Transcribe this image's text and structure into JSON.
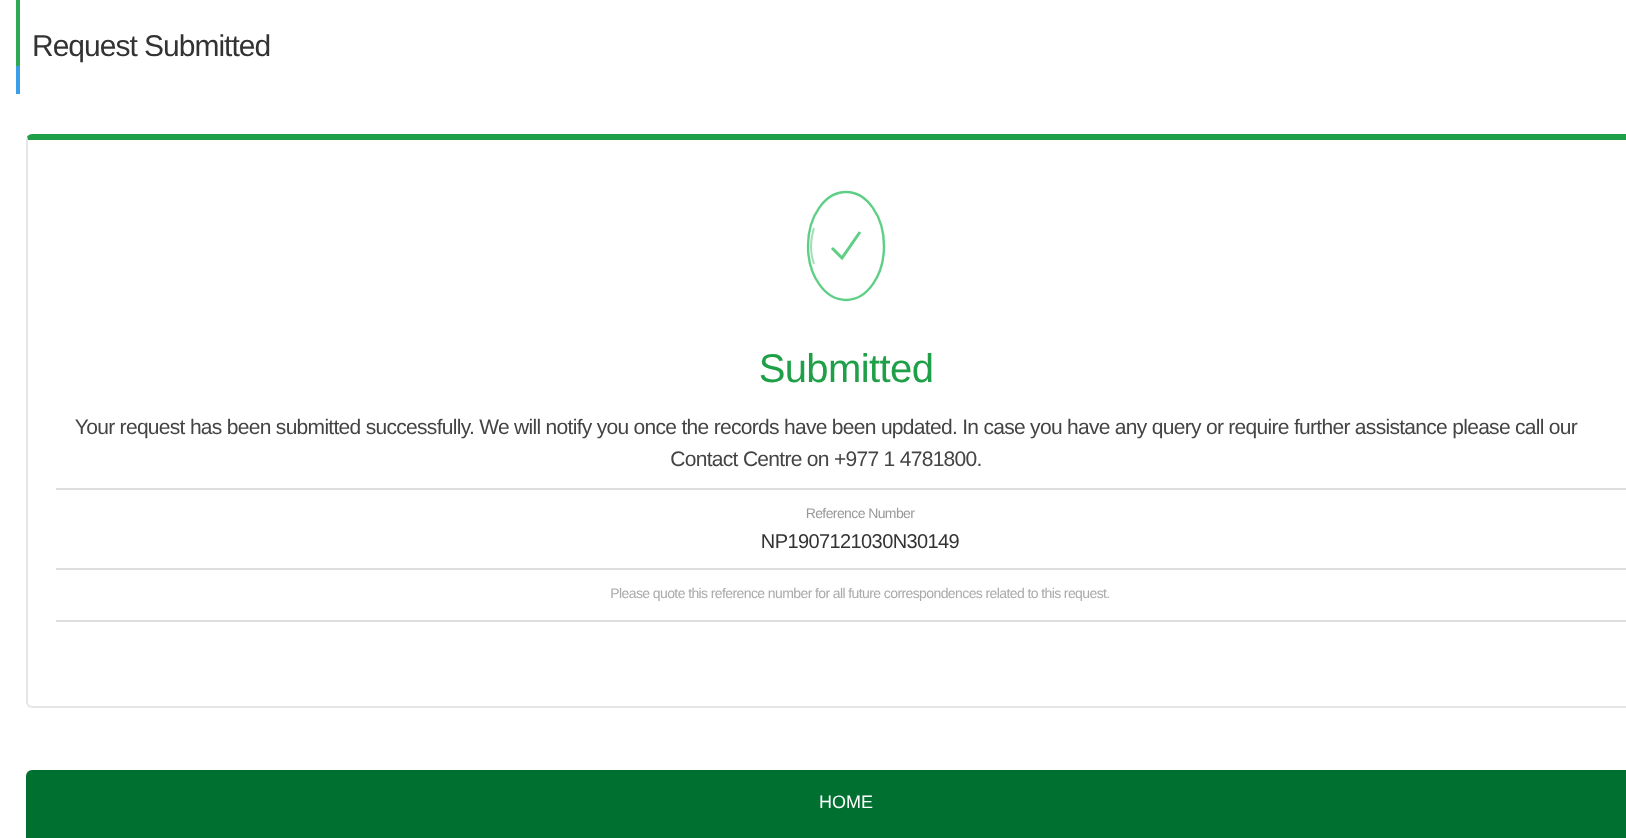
{
  "page_title": "Request Submitted",
  "status": {
    "heading": "Submitted",
    "message": "Your request has been submitted successfully. We will notify you once the records have been updated. In case you have any query or require further assistance please call our Contact Centre on +977 1 4781800."
  },
  "reference": {
    "label": "Reference Number",
    "value": "NP1907121030N30149",
    "note": "Please quote this reference number for all future correspondences related to this request."
  },
  "buttons": [
    "HOME"
  ]
}
